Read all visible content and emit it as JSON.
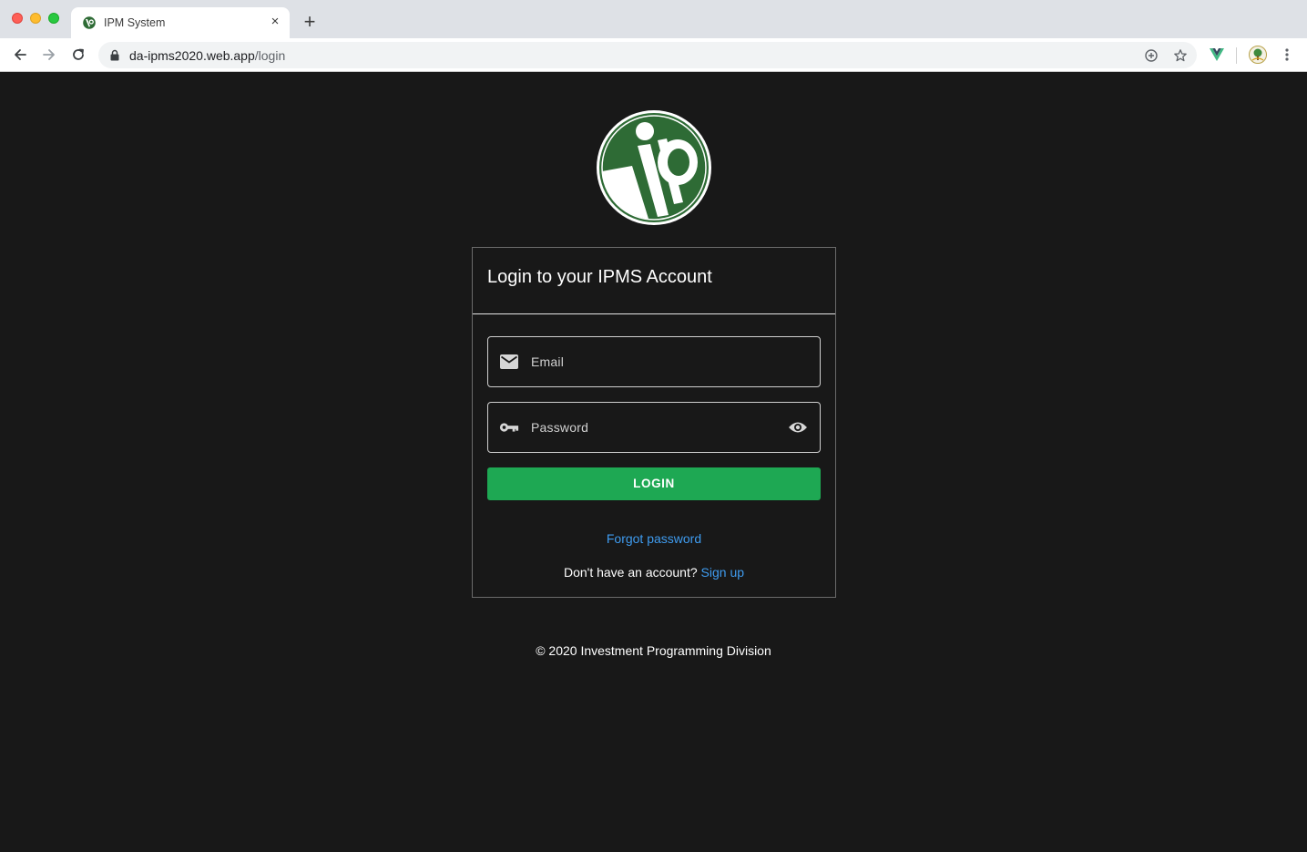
{
  "browser": {
    "tab_title": "IPM System",
    "tab_close": "×",
    "new_tab": "+",
    "url_host": "da-ipms2020.web.app",
    "url_path": "/login"
  },
  "icons": {
    "back": "arrow-left-icon",
    "forward": "arrow-right-icon",
    "reload": "reload-icon",
    "lock": "lock-icon",
    "add_bookmark": "plus-circle-icon",
    "star": "star-icon",
    "vue_ext": "vue-devtools-icon",
    "profile": "profile-avatar-icon",
    "menu": "kebab-menu-icon"
  },
  "login": {
    "title": "Login to your IPMS Account",
    "email_label": "Email",
    "password_label": "Password",
    "button_label": "LOGIN",
    "forgot_label": "Forgot password",
    "no_account_text": "Don't have an account?",
    "signup_label": "Sign up"
  },
  "footer": {
    "text": "© 2020 Investment Programming Division"
  },
  "colors": {
    "page_bg": "#181818",
    "accent_green": "#1ea853",
    "link_blue": "#3f9cf0",
    "logo_green": "#2e6b35"
  }
}
